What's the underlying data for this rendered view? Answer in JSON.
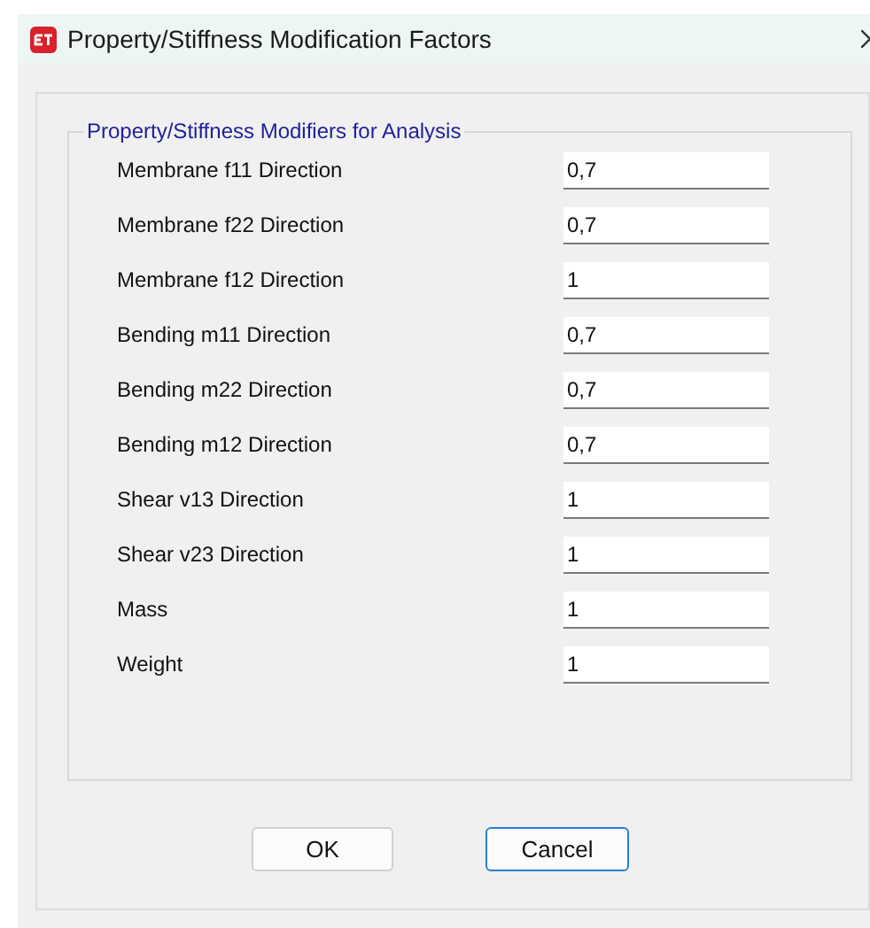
{
  "window": {
    "title": "Property/Stiffness Modification Factors"
  },
  "group": {
    "title": "Property/Stiffness Modifiers for Analysis",
    "fields": [
      {
        "label": "Membrane f11 Direction",
        "value": "0,7"
      },
      {
        "label": "Membrane f22 Direction",
        "value": "0,7"
      },
      {
        "label": "Membrane f12 Direction",
        "value": "1"
      },
      {
        "label": "Bending m11 Direction",
        "value": "0,7"
      },
      {
        "label": "Bending m22 Direction",
        "value": "0,7"
      },
      {
        "label": "Bending m12 Direction",
        "value": "0,7"
      },
      {
        "label": "Shear v13 Direction",
        "value": "1"
      },
      {
        "label": "Shear v23 Direction",
        "value": "1"
      },
      {
        "label": "Mass",
        "value": "1"
      },
      {
        "label": "Weight",
        "value": "1"
      }
    ]
  },
  "buttons": [
    {
      "label": "OK",
      "focused": false
    },
    {
      "label": "Cancel",
      "focused": true
    }
  ]
}
